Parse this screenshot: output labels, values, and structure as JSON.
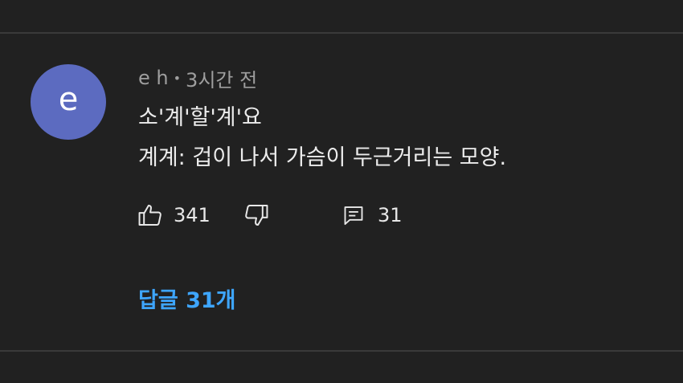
{
  "comment": {
    "avatar_letter": "e",
    "avatar_color": "#5c6bc0",
    "author": "e h",
    "separator": "•",
    "time": "3시간 전",
    "text_line1": "소'계'할'계'요",
    "text_line2": "계계: 겁이 나서 가슴이 두근거리는 모양.",
    "like_count": "341",
    "reply_count": "31",
    "replies_link": "답글 31개",
    "icons": {
      "like": "thumbs-up-icon",
      "dislike": "thumbs-down-icon",
      "reply": "comment-icon"
    }
  },
  "colors": {
    "background": "#212121",
    "link": "#3ea6ff",
    "text": "#ececec",
    "meta": "#9e9e9e"
  }
}
